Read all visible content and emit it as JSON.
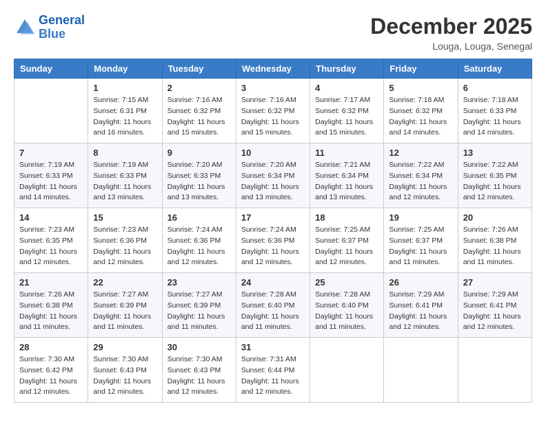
{
  "header": {
    "logo_line1": "General",
    "logo_line2": "Blue",
    "month": "December 2025",
    "location": "Louga, Louga, Senegal"
  },
  "weekdays": [
    "Sunday",
    "Monday",
    "Tuesday",
    "Wednesday",
    "Thursday",
    "Friday",
    "Saturday"
  ],
  "weeks": [
    [
      {
        "day": "",
        "sunrise": "",
        "sunset": "",
        "daylight": ""
      },
      {
        "day": "1",
        "sunrise": "Sunrise: 7:15 AM",
        "sunset": "Sunset: 6:31 PM",
        "daylight": "Daylight: 11 hours and 16 minutes."
      },
      {
        "day": "2",
        "sunrise": "Sunrise: 7:16 AM",
        "sunset": "Sunset: 6:32 PM",
        "daylight": "Daylight: 11 hours and 15 minutes."
      },
      {
        "day": "3",
        "sunrise": "Sunrise: 7:16 AM",
        "sunset": "Sunset: 6:32 PM",
        "daylight": "Daylight: 11 hours and 15 minutes."
      },
      {
        "day": "4",
        "sunrise": "Sunrise: 7:17 AM",
        "sunset": "Sunset: 6:32 PM",
        "daylight": "Daylight: 11 hours and 15 minutes."
      },
      {
        "day": "5",
        "sunrise": "Sunrise: 7:18 AM",
        "sunset": "Sunset: 6:32 PM",
        "daylight": "Daylight: 11 hours and 14 minutes."
      },
      {
        "day": "6",
        "sunrise": "Sunrise: 7:18 AM",
        "sunset": "Sunset: 6:33 PM",
        "daylight": "Daylight: 11 hours and 14 minutes."
      }
    ],
    [
      {
        "day": "7",
        "sunrise": "Sunrise: 7:19 AM",
        "sunset": "Sunset: 6:33 PM",
        "daylight": "Daylight: 11 hours and 14 minutes."
      },
      {
        "day": "8",
        "sunrise": "Sunrise: 7:19 AM",
        "sunset": "Sunset: 6:33 PM",
        "daylight": "Daylight: 11 hours and 13 minutes."
      },
      {
        "day": "9",
        "sunrise": "Sunrise: 7:20 AM",
        "sunset": "Sunset: 6:33 PM",
        "daylight": "Daylight: 11 hours and 13 minutes."
      },
      {
        "day": "10",
        "sunrise": "Sunrise: 7:20 AM",
        "sunset": "Sunset: 6:34 PM",
        "daylight": "Daylight: 11 hours and 13 minutes."
      },
      {
        "day": "11",
        "sunrise": "Sunrise: 7:21 AM",
        "sunset": "Sunset: 6:34 PM",
        "daylight": "Daylight: 11 hours and 13 minutes."
      },
      {
        "day": "12",
        "sunrise": "Sunrise: 7:22 AM",
        "sunset": "Sunset: 6:34 PM",
        "daylight": "Daylight: 11 hours and 12 minutes."
      },
      {
        "day": "13",
        "sunrise": "Sunrise: 7:22 AM",
        "sunset": "Sunset: 6:35 PM",
        "daylight": "Daylight: 11 hours and 12 minutes."
      }
    ],
    [
      {
        "day": "14",
        "sunrise": "Sunrise: 7:23 AM",
        "sunset": "Sunset: 6:35 PM",
        "daylight": "Daylight: 11 hours and 12 minutes."
      },
      {
        "day": "15",
        "sunrise": "Sunrise: 7:23 AM",
        "sunset": "Sunset: 6:36 PM",
        "daylight": "Daylight: 11 hours and 12 minutes."
      },
      {
        "day": "16",
        "sunrise": "Sunrise: 7:24 AM",
        "sunset": "Sunset: 6:36 PM",
        "daylight": "Daylight: 11 hours and 12 minutes."
      },
      {
        "day": "17",
        "sunrise": "Sunrise: 7:24 AM",
        "sunset": "Sunset: 6:36 PM",
        "daylight": "Daylight: 11 hours and 12 minutes."
      },
      {
        "day": "18",
        "sunrise": "Sunrise: 7:25 AM",
        "sunset": "Sunset: 6:37 PM",
        "daylight": "Daylight: 11 hours and 12 minutes."
      },
      {
        "day": "19",
        "sunrise": "Sunrise: 7:25 AM",
        "sunset": "Sunset: 6:37 PM",
        "daylight": "Daylight: 11 hours and 11 minutes."
      },
      {
        "day": "20",
        "sunrise": "Sunrise: 7:26 AM",
        "sunset": "Sunset: 6:38 PM",
        "daylight": "Daylight: 11 hours and 11 minutes."
      }
    ],
    [
      {
        "day": "21",
        "sunrise": "Sunrise: 7:26 AM",
        "sunset": "Sunset: 6:38 PM",
        "daylight": "Daylight: 11 hours and 11 minutes."
      },
      {
        "day": "22",
        "sunrise": "Sunrise: 7:27 AM",
        "sunset": "Sunset: 6:39 PM",
        "daylight": "Daylight: 11 hours and 11 minutes."
      },
      {
        "day": "23",
        "sunrise": "Sunrise: 7:27 AM",
        "sunset": "Sunset: 6:39 PM",
        "daylight": "Daylight: 11 hours and 11 minutes."
      },
      {
        "day": "24",
        "sunrise": "Sunrise: 7:28 AM",
        "sunset": "Sunset: 6:40 PM",
        "daylight": "Daylight: 11 hours and 11 minutes."
      },
      {
        "day": "25",
        "sunrise": "Sunrise: 7:28 AM",
        "sunset": "Sunset: 6:40 PM",
        "daylight": "Daylight: 11 hours and 11 minutes."
      },
      {
        "day": "26",
        "sunrise": "Sunrise: 7:29 AM",
        "sunset": "Sunset: 6:41 PM",
        "daylight": "Daylight: 11 hours and 12 minutes."
      },
      {
        "day": "27",
        "sunrise": "Sunrise: 7:29 AM",
        "sunset": "Sunset: 6:41 PM",
        "daylight": "Daylight: 11 hours and 12 minutes."
      }
    ],
    [
      {
        "day": "28",
        "sunrise": "Sunrise: 7:30 AM",
        "sunset": "Sunset: 6:42 PM",
        "daylight": "Daylight: 11 hours and 12 minutes."
      },
      {
        "day": "29",
        "sunrise": "Sunrise: 7:30 AM",
        "sunset": "Sunset: 6:43 PM",
        "daylight": "Daylight: 11 hours and 12 minutes."
      },
      {
        "day": "30",
        "sunrise": "Sunrise: 7:30 AM",
        "sunset": "Sunset: 6:43 PM",
        "daylight": "Daylight: 11 hours and 12 minutes."
      },
      {
        "day": "31",
        "sunrise": "Sunrise: 7:31 AM",
        "sunset": "Sunset: 6:44 PM",
        "daylight": "Daylight: 11 hours and 12 minutes."
      },
      {
        "day": "",
        "sunrise": "",
        "sunset": "",
        "daylight": ""
      },
      {
        "day": "",
        "sunrise": "",
        "sunset": "",
        "daylight": ""
      },
      {
        "day": "",
        "sunrise": "",
        "sunset": "",
        "daylight": ""
      }
    ]
  ]
}
